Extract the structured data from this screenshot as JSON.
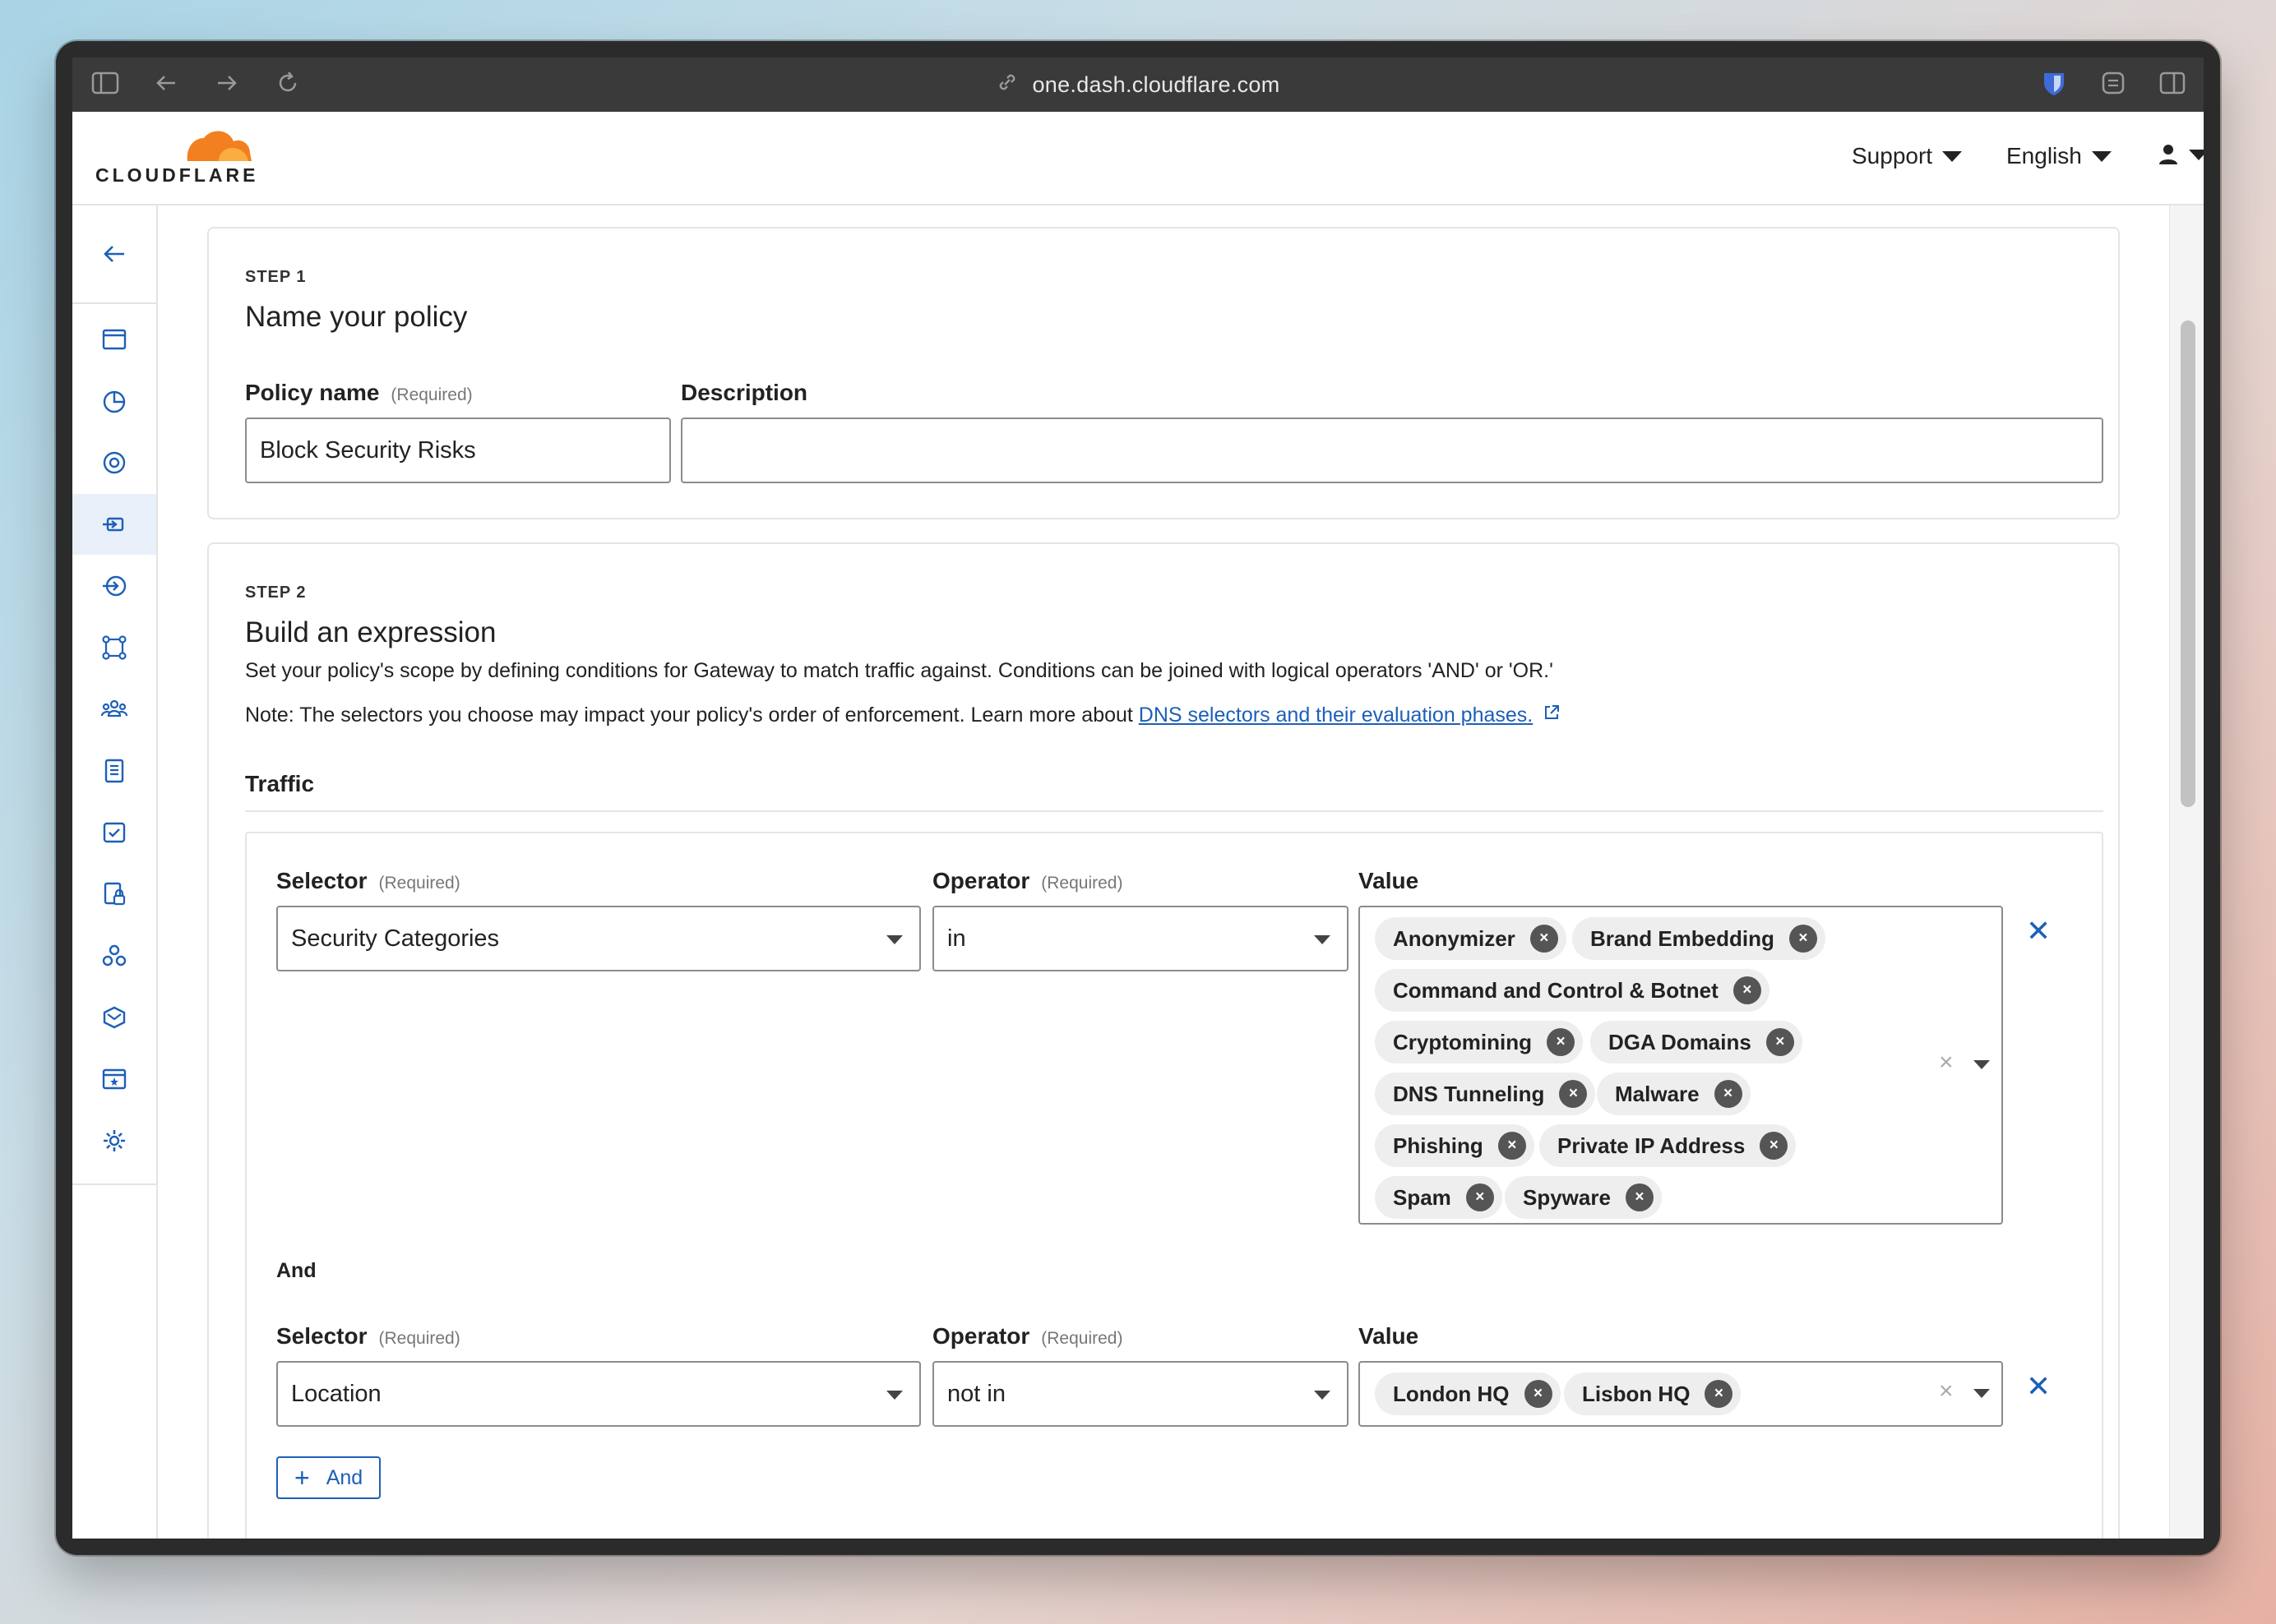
{
  "browser": {
    "url": "one.dash.cloudflare.com"
  },
  "brand": {
    "name": "CLOUDFLARE",
    "accent": "#f38020"
  },
  "topnav": {
    "support": "Support",
    "language": "English"
  },
  "step1": {
    "step_label": "STEP 1",
    "title": "Name your policy",
    "policy_name_label": "Policy name",
    "required": "(Required)",
    "policy_name_value": "Block Security Risks",
    "description_label": "Description",
    "description_value": ""
  },
  "step2": {
    "step_label": "STEP 2",
    "title": "Build an expression",
    "intro": "Set your policy's scope by defining conditions for Gateway to match traffic against. Conditions can be joined with logical operators 'AND' or 'OR.'",
    "note_prefix": "Note: The selectors you choose may impact your policy's order of enforcement. Learn more about ",
    "note_link": "DNS selectors and their evaluation phases.",
    "traffic_title": "Traffic",
    "selector_label": "Selector",
    "operator_label": "Operator",
    "value_label": "Value",
    "required": "(Required)",
    "and_text": "And",
    "and_button": "And",
    "rule1": {
      "selector": "Security Categories",
      "operator": "in",
      "values": [
        "Anonymizer",
        "Brand Embedding",
        "Command and Control & Botnet",
        "Cryptomining",
        "DGA Domains",
        "DNS Tunneling",
        "Malware",
        "Phishing",
        "Private IP Address",
        "Spam",
        "Spyware"
      ]
    },
    "rule2": {
      "selector": "Location",
      "operator": "not in",
      "values": [
        "London HQ",
        "Lisbon HQ"
      ]
    }
  },
  "icons": {
    "chip_remove": "×",
    "clear": "×",
    "row_remove": "✕"
  }
}
